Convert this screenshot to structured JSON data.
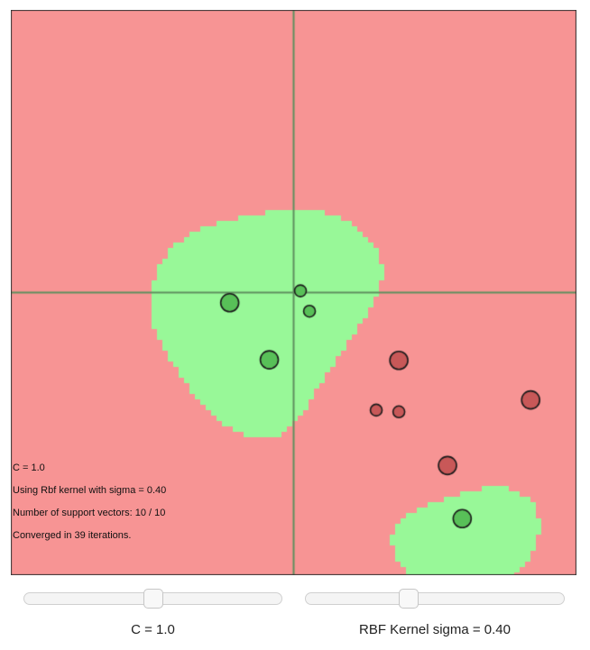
{
  "plot": {
    "background_positive": "#98f898",
    "background_negative": "#f79494",
    "axis_color": "#5f8f5f",
    "point_positive_color": "#58c058",
    "point_negative_color": "#c85858",
    "range": [
      -5,
      5
    ],
    "points": [
      {
        "x": -1.13,
        "y": -0.18,
        "label": 1
      },
      {
        "x": 0.12,
        "y": 0.03,
        "label": 1
      },
      {
        "x": 0.28,
        "y": -0.33,
        "label": 1
      },
      {
        "x": -0.43,
        "y": -1.19,
        "label": 1
      },
      {
        "x": 2.98,
        "y": -4.0,
        "label": 1
      },
      {
        "x": 1.86,
        "y": -1.2,
        "label": -1
      },
      {
        "x": 1.46,
        "y": -2.08,
        "label": -1
      },
      {
        "x": 1.86,
        "y": -2.11,
        "label": -1
      },
      {
        "x": 4.19,
        "y": -1.9,
        "label": -1
      },
      {
        "x": 2.72,
        "y": -3.06,
        "label": -1
      }
    ],
    "support_vector_flags": [
      true,
      false,
      false,
      true,
      true,
      true,
      false,
      false,
      true,
      true
    ]
  },
  "info": {
    "line1": "C = 1.0",
    "line2": "Using Rbf kernel with sigma = 0.40",
    "line3": "Number of support vectors: 10 / 10",
    "line4": "Converged in 39 iterations."
  },
  "controls": {
    "c_slider_value": 0.5,
    "sigma_slider_value": 0.4,
    "c_caption": "C = 1.0",
    "sigma_caption": "RBF Kernel sigma = 0.40"
  }
}
